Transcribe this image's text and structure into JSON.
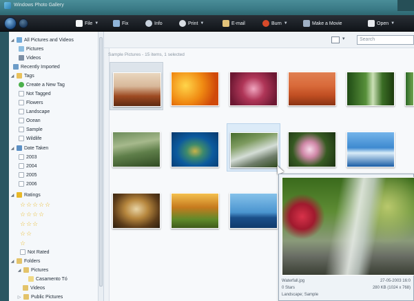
{
  "window": {
    "title": "Windows Photo Gallery"
  },
  "toolbar": {
    "file": "File",
    "fix": "Fix",
    "info": "Info",
    "print": "Print",
    "email": "E-mail",
    "burn": "Burn",
    "make_movie": "Make a Movie",
    "open": "Open"
  },
  "sidebar": {
    "all": "All Pictures and Videos",
    "pictures": "Pictures",
    "videos": "Videos",
    "recently_imported": "Recently Imported",
    "tags": "Tags",
    "create_tag": "Create a New Tag",
    "not_tagged": "Not Tagged",
    "flowers": "Flowers",
    "landscape": "Landscape",
    "ocean": "Ocean",
    "sample": "Sample",
    "wildlife": "Wildlife",
    "date_taken": "Date Taken",
    "y2003": "2003",
    "y2004": "2004",
    "y2005": "2005",
    "y2006": "2006",
    "ratings": "Ratings",
    "not_rated": "Not Rated",
    "folders": "Folders",
    "f_pictures": "Pictures",
    "casamento": "Casamento Tó",
    "f_videos": "Videos",
    "public_pictures": "Public Pictures"
  },
  "main": {
    "search_placeholder": "Search",
    "group_header": "Sample Pictures - 15 items, 1 selected"
  },
  "preview": {
    "filename": "Waterfall.jpg",
    "date": "27-05-2003 16:0",
    "rating": "0 Stars",
    "size": "280 KB (1024 x 768)",
    "tags": "Landscape; Sample"
  }
}
